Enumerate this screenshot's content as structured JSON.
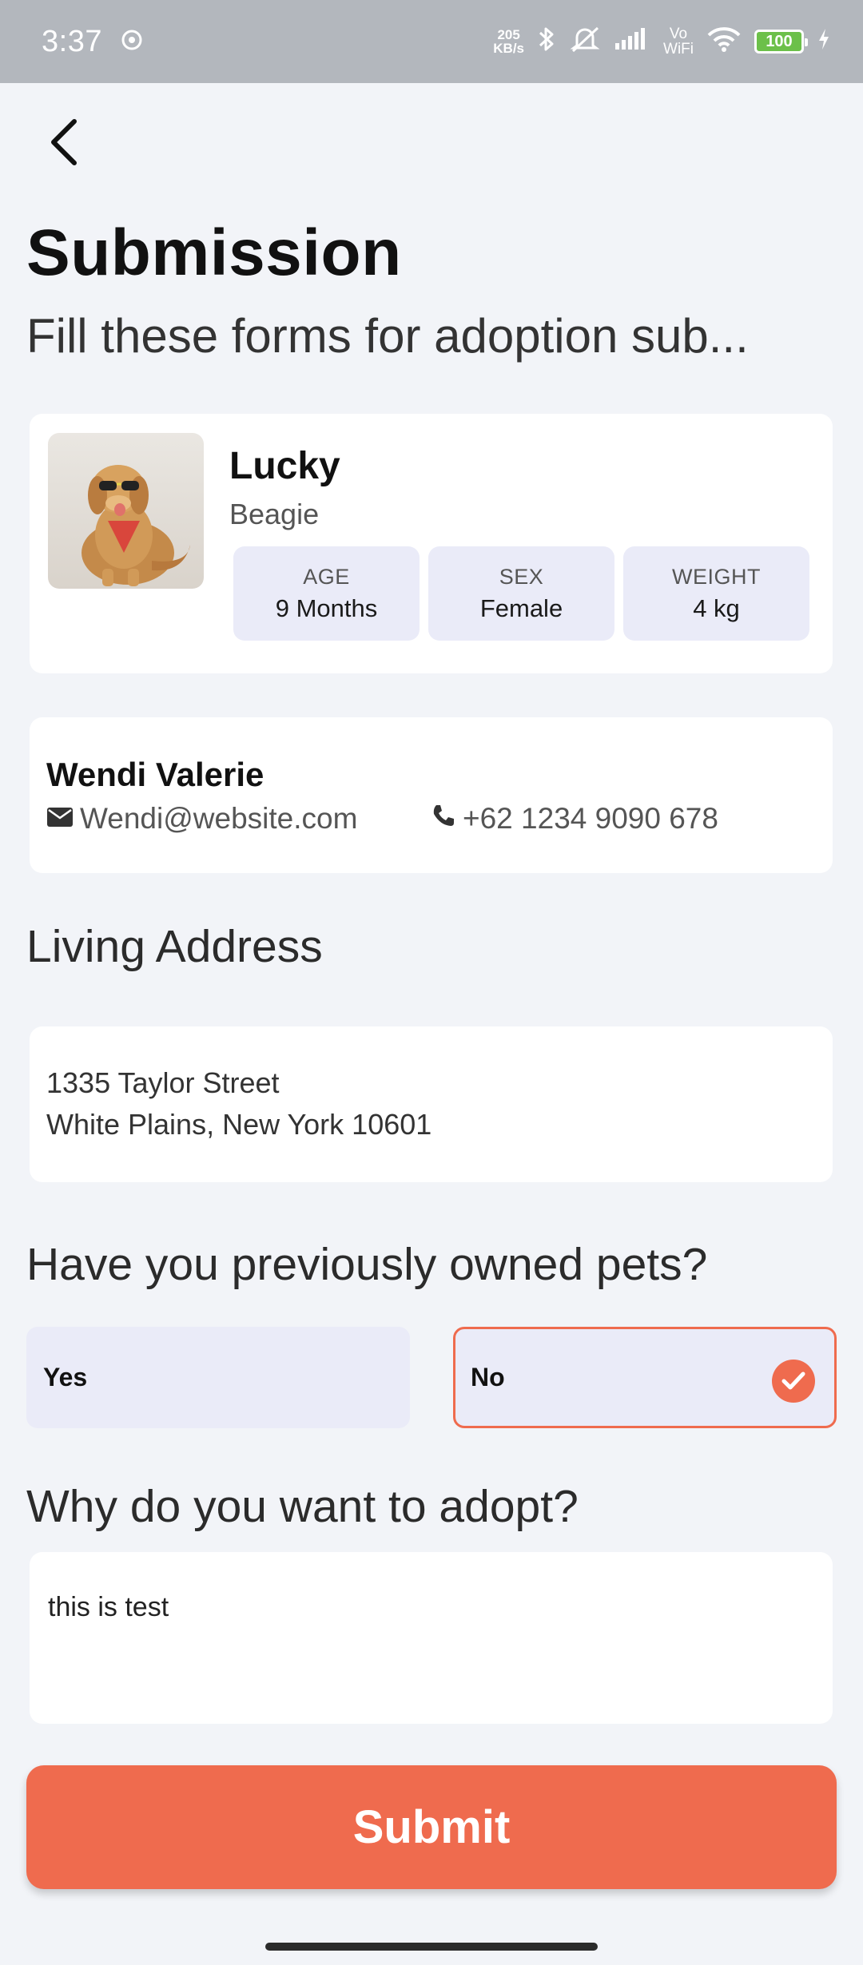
{
  "status_bar": {
    "time": "3:37",
    "net_speed_value": "205",
    "net_speed_unit": "KB/s",
    "vowifi_top": "Vo",
    "vowifi_bottom": "WiFi",
    "battery": "100",
    "icons": [
      "notification-dot-icon",
      "bluetooth-icon",
      "mute-icon",
      "signal-icon",
      "wifi-icon",
      "battery-icon",
      "charging-icon"
    ]
  },
  "header": {
    "back_icon": "chevron-left-icon",
    "title": "Submission",
    "subtitle": "Fill these forms for adoption sub..."
  },
  "pet": {
    "name": "Lucky",
    "breed": "Beagie",
    "stats": [
      {
        "label": "AGE",
        "value": "9 Months"
      },
      {
        "label": "SEX",
        "value": "Female"
      },
      {
        "label": "WEIGHT",
        "value": "4 kg"
      }
    ]
  },
  "owner": {
    "name": "Wendi Valerie",
    "email": "Wendi@website.com",
    "phone": "+62 1234 9090 678"
  },
  "address": {
    "heading": "Living Address",
    "line1": "1335 Taylor Street",
    "line2": "White Plains, New York 10601"
  },
  "previous_pets": {
    "question": "Have you previously owned pets?",
    "options": [
      "Yes",
      "No"
    ],
    "selected": "No"
  },
  "reason": {
    "question": "Why do you want to adopt?",
    "value": "this is test"
  },
  "submit_label": "Submit",
  "colors": {
    "accent": "#ef6b4e",
    "chip_bg": "#eaebf8",
    "page_bg": "#f2f4f8",
    "status_bar_bg": "#b3b7bd"
  }
}
